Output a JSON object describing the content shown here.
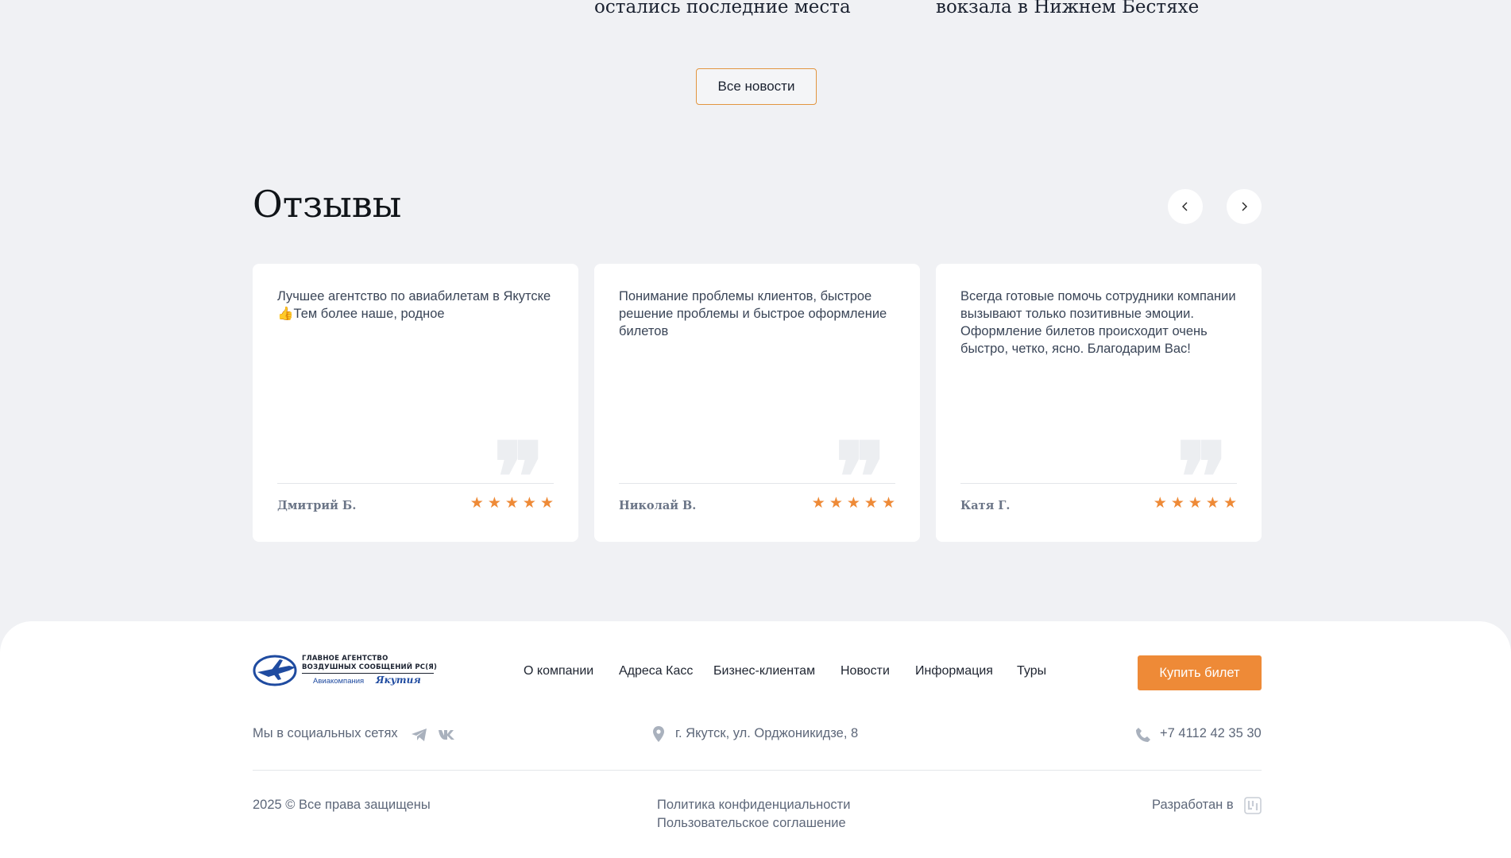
{
  "news": {
    "item1_title_tail": "остались последние места",
    "item2_title_tail": "вокзала в Нижнем Бестяхе",
    "all_news_label": "Все новости"
  },
  "reviews": {
    "title": "Отзывы",
    "prev_icon": "chevron-left-icon",
    "next_icon": "chevron-right-icon",
    "items": [
      {
        "text": "Лучшее агентство по авиабилетам в Якутске 👍Тем более наше, родное",
        "author": "Дмитрий Б.",
        "rating": 5
      },
      {
        "text": "Понимание проблемы клиентов, быстрое решение проблемы и быстрое оформление билетов",
        "author": "Николай В.",
        "rating": 5
      },
      {
        "text": "Всегда готовые помочь сотрудники компании вызывают только позитивные эмоции. Оформление билетов происходит очень быстро, четко, ясно. Благодарим Вас!",
        "author": "Катя Г.",
        "rating": 5
      }
    ],
    "quote_glyph": "❞"
  },
  "footer": {
    "logo": {
      "line1": "ГЛАВНОЕ АГЕНТСТВО",
      "line2": "ВОЗДУШНЫХ СООБЩЕНИЙ РС(Я)",
      "sub": "Авиакомпания",
      "script": "Якутия"
    },
    "nav": [
      "О компании",
      "Адреса Касс",
      "Бизнес-клиентам",
      "Новости",
      "Информация",
      "Туры"
    ],
    "buy_ticket": "Купить билет",
    "social_label": "Мы в социальных сетях",
    "address": "г. Якутск, ул. Орджоникидзе, 8",
    "phone": "+7 4112 42 35 30",
    "copyright": "2025 © Все права защищены",
    "privacy": "Политика конфиденциальности",
    "agreement": "Пользовательское соглашение",
    "developed_by": "Разработан в"
  },
  "colors": {
    "accent": "#ee8a37",
    "page_bg": "#f0f1f4",
    "card_bg": "#ffffff",
    "text_muted": "#5d6779"
  }
}
